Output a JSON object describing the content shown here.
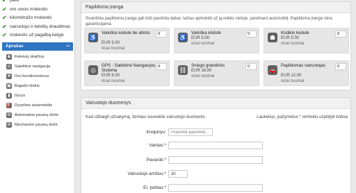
{
  "sidebar": {
    "checklist": [
      {
        "label": "pavir"
      },
      {
        "label": "oro uosto mokestis"
      },
      {
        "label": "kilometražo mokestis"
      },
      {
        "label": "vairuotojo ir kelvilių draudimas"
      },
      {
        "label": "mokestis už pagalbą kelyje"
      }
    ],
    "description_header": "Aprašas",
    "description_toggle": "−",
    "features": [
      {
        "label": "Keleivių skaičius",
        "icon": "person-icon"
      },
      {
        "label": "Satelitinė navigacija",
        "icon": "gps-icon"
      },
      {
        "label": "Oro kondicionierius",
        "icon": "snowflake-icon"
      },
      {
        "label": "Bagažo kiekis",
        "icon": "suitcase-icon"
      },
      {
        "label": "Durys",
        "icon": "door-icon"
      },
      {
        "label": "Dyzelinis automobilis",
        "icon": "fuel-icon"
      },
      {
        "label": "Automatinė pavarų dėžė",
        "icon": "gearbox-icon"
      },
      {
        "label": "Mechaninė pavarų dėžė",
        "icon": "gearbox-icon"
      }
    ]
  },
  "equipment": {
    "title": "Papildoma įranga",
    "intro": "Išvardinta papildoma įranga gali būti pasiimta dabar, tačiau apmokėti už ją reikės vietoje, pasiimant automobilį. Papildoma įranga nėra garantuojama.",
    "items": [
      {
        "name": "Vaikiška kėdutė be atlošo",
        "price": "EUR 5.00",
        "note": "visai nuomai",
        "qty": "0",
        "icon": "child-seat-icon"
      },
      {
        "name": "Vaikiška kėdutė",
        "price": "EUR 5.00",
        "note": "visai nuomai",
        "qty": "0",
        "icon": "child-seat-icon"
      },
      {
        "name": "Kūdikio kėdutė",
        "price": "EUR 5.00",
        "note": "visai nuomai",
        "qty": "0",
        "icon": "baby-seat-icon"
      },
      {
        "name": "GPS - Satelitinė Navigacijos Sistema",
        "price": "EUR 8.00",
        "note": "visai nuomai",
        "qty": "0",
        "icon": "gps-icon"
      },
      {
        "name": "Sniego grandinės",
        "price": "EUR 18.00",
        "note": "visai nuomai",
        "qty": "0",
        "icon": "snow-chain-icon"
      },
      {
        "name": "Papildomas vairuotojas",
        "price": "EUR 12.00",
        "note": "visai nuomai",
        "qty": "0",
        "icon": "driver-icon"
      }
    ]
  },
  "driver": {
    "title": "Vairuotojo duomenys",
    "intro": "Kad užbaigti užsakymą, žemiau suveskite vairuotojo duomenis.",
    "required_note": "Laukeliųs, pažymėtus * simboliu užpildyti būtina",
    "fields": {
      "salutation": {
        "label": "Kreipinys:",
        "placeholder": "Prašome pasirinkti..."
      },
      "first_name": {
        "label": "Vardas:",
        "value": ""
      },
      "last_name": {
        "label": "Pavardė:",
        "value": ""
      },
      "age": {
        "label": "Vairuotojo amžius:",
        "value": "30"
      },
      "email": {
        "label": "El. paštas:",
        "value": ""
      }
    }
  }
}
